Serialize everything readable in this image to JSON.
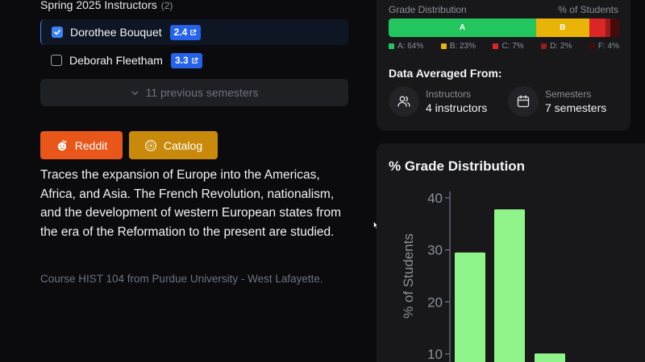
{
  "instructors_section": {
    "title": "Spring 2025 Instructors",
    "count": "(2)",
    "items": [
      {
        "name": "Dorothee Bouquet",
        "gpa": "2.4",
        "checked": true
      },
      {
        "name": "Deborah Fleetham",
        "gpa": "3.3",
        "checked": false
      }
    ],
    "previous_semesters": "11 previous semesters"
  },
  "buttons": {
    "reddit": "Reddit",
    "catalog": "Catalog"
  },
  "description": "Traces the expansion of Europe into the Americas, Africa, and Asia. The French Revolution, nationalism, and the development of western European states from the era of the Reformation to the present are studied.",
  "course_meta": "Course HIST 104 from Purdue University - West Lafayette.",
  "summary_card": {
    "grade_distribution_label": "Grade Distribution",
    "percent_label": "% of Students",
    "segments": [
      {
        "grade": "A",
        "percent": 64,
        "color": "#22c55e",
        "label": "A"
      },
      {
        "grade": "B",
        "percent": 23,
        "color": "#eab308",
        "label": "B"
      },
      {
        "grade": "C",
        "percent": 7,
        "color": "#dc2626",
        "label": ""
      },
      {
        "grade": "D",
        "percent": 2,
        "color": "#991b1b",
        "label": ""
      },
      {
        "grade": "F",
        "percent": 4,
        "color": "#450a0a",
        "label": ""
      }
    ],
    "legend": [
      "A: 64%",
      "B: 23%",
      "C: 7%",
      "D: 2%",
      "F: 4%"
    ],
    "data_averaged_title": "Data Averaged From:",
    "instructors_label": "Instructors",
    "instructors_value": "4 instructors",
    "semesters_label": "Semesters",
    "semesters_value": "7 semesters"
  },
  "accent_colors": {
    "primary": "#3b82f6",
    "reddit": "#e8561a",
    "catalog": "#c98a0b",
    "bar": "#86ef8c"
  },
  "chart_data": {
    "type": "bar",
    "title": "% Grade Distribution",
    "ylabel": "% of Students",
    "yticks": [
      10,
      20,
      30,
      40
    ],
    "ylim": [
      0,
      42
    ],
    "values": [
      29.5,
      37.8,
      10.1
    ],
    "bar_color": "#8ff58a"
  }
}
